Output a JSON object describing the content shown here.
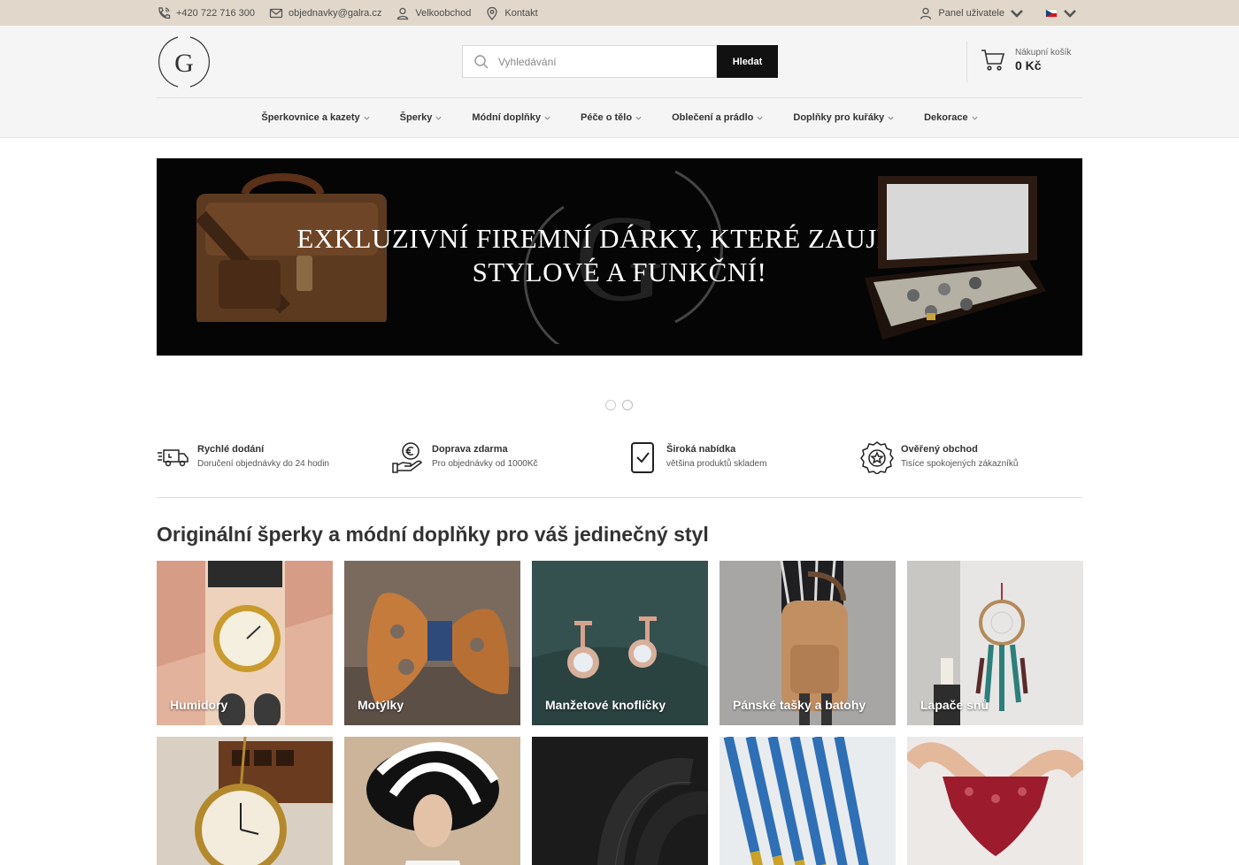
{
  "topbar": {
    "phone": "+420 722 716 300",
    "email": "objednavky@galra.cz",
    "wholesale": "Velkoobchod",
    "contact": "Kontakt",
    "user_panel": "Panel uživatele"
  },
  "header": {
    "search_placeholder": "Vyhledávání",
    "search_button": "Hledat",
    "cart_label": "Nákupní košík",
    "cart_amount": "0 Kč"
  },
  "nav": {
    "items": [
      {
        "label": "Šperkovnice a kazety"
      },
      {
        "label": "Šperky"
      },
      {
        "label": "Módní doplňky"
      },
      {
        "label": "Péče o tělo"
      },
      {
        "label": "Oblečení a prádlo"
      },
      {
        "label": "Doplňky pro kuřáky"
      },
      {
        "label": "Dekorace"
      }
    ]
  },
  "banner": {
    "line1": "EXKLUZIVNÍ FIREMNÍ DÁRKY, KTERÉ ZAUJMOU",
    "line2": "STYLOVÉ A FUNKČNÍ!"
  },
  "features": [
    {
      "title": "Rychlé dodání",
      "subtitle": "Doručení objednávky do 24 hodin",
      "icon": "delivery-truck-icon"
    },
    {
      "title": "Doprava zdarma",
      "subtitle": "Pro objednávky od 1000Kč",
      "icon": "euro-hand-icon"
    },
    {
      "title": "Široká nabídka",
      "subtitle": "většina produktů skladem",
      "icon": "checklist-icon"
    },
    {
      "title": "Ověřený obchod",
      "subtitle": "Tisíce spokojených zákazníků",
      "icon": "award-badge-icon"
    }
  ],
  "section_title": "Originální šperky a módní doplňky pro váš jedinečný styl",
  "categories": [
    {
      "label": "Humidory"
    },
    {
      "label": "Motýlky"
    },
    {
      "label": "Manžetové knoflíčky"
    },
    {
      "label": "Pánské tašky a batohy"
    },
    {
      "label": "Lapače snů"
    }
  ],
  "colors": {
    "topbar_bg": "#e1d8cb",
    "header_bg": "#f5f5f5",
    "search_button_bg": "#111111",
    "banner_bg": "#050505"
  }
}
